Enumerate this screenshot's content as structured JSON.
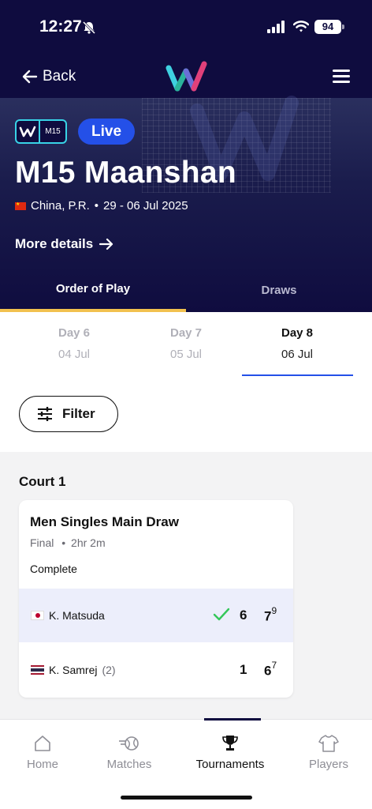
{
  "status_bar": {
    "time": "12:27",
    "battery": "94"
  },
  "nav": {
    "back_label": "Back"
  },
  "tournament": {
    "level": "M15",
    "live_label": "Live",
    "name": "M15 Maanshan",
    "country": "China, P.R.",
    "dates": "29 - 06 Jul 2025",
    "separator": "•",
    "more_details_label": "More details"
  },
  "tabs": [
    {
      "label": "Order of Play",
      "active": true
    },
    {
      "label": "Draws",
      "active": false
    }
  ],
  "days": [
    {
      "day": "Day 6",
      "date": "04 Jul",
      "selected": false
    },
    {
      "day": "Day 7",
      "date": "05 Jul",
      "selected": false
    },
    {
      "day": "Day 8",
      "date": "06 Jul",
      "selected": true
    }
  ],
  "filter_label": "Filter",
  "court": {
    "name": "Court 1",
    "match": {
      "event": "Men Singles Main Draw",
      "round": "Final",
      "duration": "2hr 2m",
      "status": "Complete",
      "players": [
        {
          "name": "K. Matsuda",
          "seed": "",
          "flag": "japan",
          "winner": true,
          "set1": "6",
          "set2": "7",
          "tiebreak": "9"
        },
        {
          "name": "K. Samrej",
          "seed": "(2)",
          "flag": "thailand",
          "winner": false,
          "set1": "1",
          "set2": "6",
          "tiebreak": "7"
        }
      ]
    }
  },
  "bottom_nav": [
    {
      "label": "Home",
      "icon": "home-icon",
      "active": false
    },
    {
      "label": "Matches",
      "icon": "tennis-ball-icon",
      "active": false
    },
    {
      "label": "Tournaments",
      "icon": "trophy-icon",
      "active": true
    },
    {
      "label": "Players",
      "icon": "shirt-icon",
      "active": false
    }
  ],
  "colors": {
    "navy": "#0f0c3f",
    "accent_blue": "#2450e8",
    "tab_underline": "#f2c14e",
    "win_row": "#eceefb",
    "check_green": "#34c759"
  }
}
